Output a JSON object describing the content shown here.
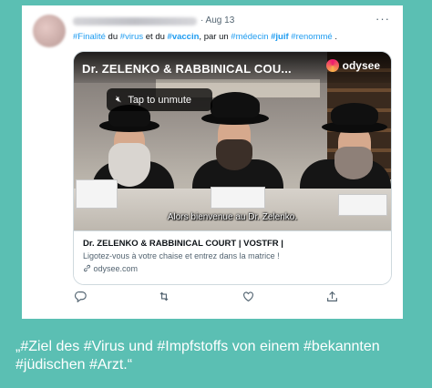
{
  "colors": {
    "background": "#5bbfb3",
    "hashtag": "#1d9bf0",
    "text": "#0f1419",
    "muted": "#536471"
  },
  "tweet": {
    "date": "· Aug 13",
    "more": "···",
    "text_parts": [
      {
        "t": "#Finalité",
        "hash": true,
        "bold": false
      },
      {
        "t": " du ",
        "hash": false,
        "bold": false
      },
      {
        "t": "#virus",
        "hash": true,
        "bold": false
      },
      {
        "t": " et du ",
        "hash": false,
        "bold": false
      },
      {
        "t": "#vaccin",
        "hash": true,
        "bold": true
      },
      {
        "t": ", par un ",
        "hash": false,
        "bold": false
      },
      {
        "t": "#médecin",
        "hash": true,
        "bold": false
      },
      {
        "t": " ",
        "hash": false,
        "bold": false
      },
      {
        "t": "#juif",
        "hash": true,
        "bold": true
      },
      {
        "t": " ",
        "hash": false,
        "bold": false
      },
      {
        "t": "#renommé",
        "hash": true,
        "bold": false
      },
      {
        "t": " .",
        "hash": false,
        "bold": false
      }
    ]
  },
  "video": {
    "title": "Dr. ZELENKO & RABBINICAL COU...",
    "brand": "odysee",
    "unmute_label": "Tap to unmute",
    "subtitle": "Alors bienvenue au Dr. Zelenko."
  },
  "link_card": {
    "title": "Dr. ZELENKO & RABBINICAL COURT | VOSTFR |",
    "description": "Ligotez-vous à votre chaise et entrez dans la matrice !",
    "domain": "odysee.com"
  },
  "actions": {
    "reply_icon": "reply-icon",
    "retweet_icon": "retweet-icon",
    "like_icon": "heart-icon",
    "share_icon": "share-icon"
  },
  "caption": "„#Ziel des #Virus und #Impfstoffs von einem #bekannten #jüdischen #Arzt.“"
}
